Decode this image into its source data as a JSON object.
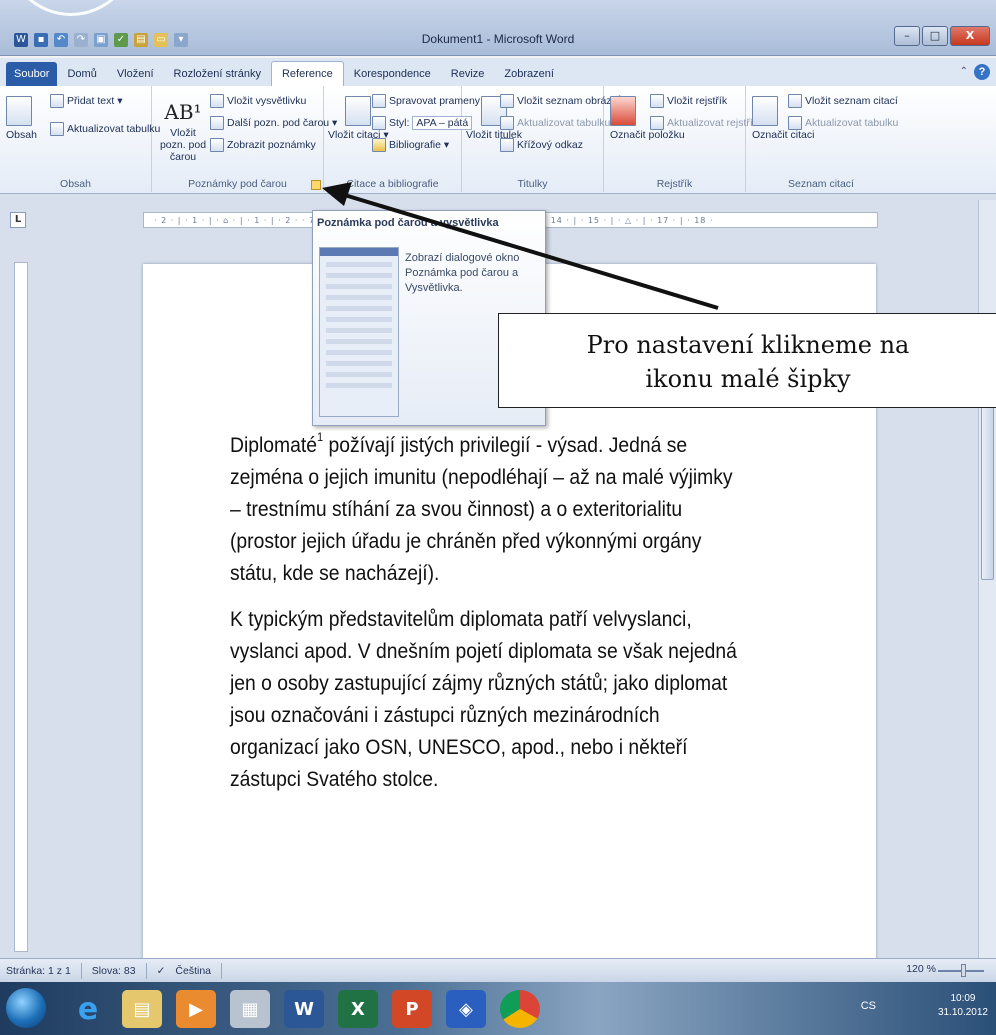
{
  "window": {
    "title": "Dokument1 - Microsoft Word",
    "minimize_label": "–",
    "maximize_label": "□",
    "close_label": "X"
  },
  "tabs": [
    "Soubor",
    "Domů",
    "Vložení",
    "Rozložení stránky",
    "Reference",
    "Korespondence",
    "Revize",
    "Zobrazení"
  ],
  "active_tab": "Reference",
  "ribbon": {
    "obsah": {
      "big_button": "Obsah",
      "add_text": "Přidat text ▾",
      "update_table": "Aktualizovat tabulku",
      "group": "Obsah"
    },
    "footnotes": {
      "insert_footnote": "Vložit pozn. pod čarou",
      "insert_endnote": "Vložit vysvětlivku",
      "next_footnote": "Další pozn. pod čarou ▾",
      "show_notes": "Zobrazit poznámky",
      "group": "Poznámky pod čarou"
    },
    "citations": {
      "insert_citation": "Vložit citaci ▾",
      "manage_sources": "Spravovat prameny",
      "style_label": "Styl:",
      "style_value": "APA – pátá",
      "bibliography": "Bibliografie ▾",
      "group": "Citace a bibliografie"
    },
    "captions": {
      "insert_caption": "Vložit titulek",
      "insert_table_figures": "Vložit seznam obrázků",
      "update_table": "Aktualizovat tabulku",
      "cross_reference": "Křížový odkaz",
      "group": "Titulky"
    },
    "index": {
      "mark_entry": "Označit položku",
      "insert_index": "Vložit rejstřík",
      "update_index": "Aktualizovat rejstřík",
      "group": "Rejstřík"
    },
    "authorities": {
      "mark_citation": "Označit citaci",
      "insert_table": "Vložit seznam citací",
      "update_table": "Aktualizovat tabulku",
      "group": "Seznam citací"
    }
  },
  "ruler": {
    "corner": "L",
    "ticks": "· 2 · | · 1 · | · ⌂ · | · 1 · | · 2 ·     · 7 · | · 8 · | · 9 · | · 10 · | · 11 · | · 12 · | · 13 · | · 14 · | · 15 · | · △ · | · 17 · | · 18 ·"
  },
  "tooltip": {
    "title": "Poznámka pod čarou a vysvětlivka",
    "body": "Zobrazí dialogové okno Poznámka pod čarou a Vysvětlivka."
  },
  "callout": {
    "line1": "Pro nastavení klikneme na",
    "line2": "ikonu malé šipky"
  },
  "document": {
    "p1_start": "Diplomaté",
    "p1_sup": "1",
    "p1_rest": " požívají jistých privilegií - výsad. Jedná se zejména o jejich imunitu (nepodléhají – až na malé výjimky – trestnímu stíhání za svou činnost) a o exteritorialitu (prostor jejich úřadu je chráněn před výkonnými orgány státu, kde se nacházejí).",
    "p2": "K typickým představitelům diplomata patří velvyslanci, vyslanci apod. V dnešním pojetí diplomata se však nejedná jen o osoby zastupující zájmy různých států; jako diplomat jsou označováni i zástupci různých mezinárodních organizací jako OSN, UNESCO, apod., nebo i někteří zástupci Svatého stolce."
  },
  "status": {
    "page": "Stránka: 1 z 1",
    "words": "Slova: 83",
    "language": "Čeština",
    "zoom": "120 %"
  },
  "taskbar": {
    "lang": "CS",
    "time": "10:09",
    "date": "31.10.2012"
  },
  "colors": {
    "file_tab": "#2a5ca8",
    "arrow": "#111111"
  }
}
